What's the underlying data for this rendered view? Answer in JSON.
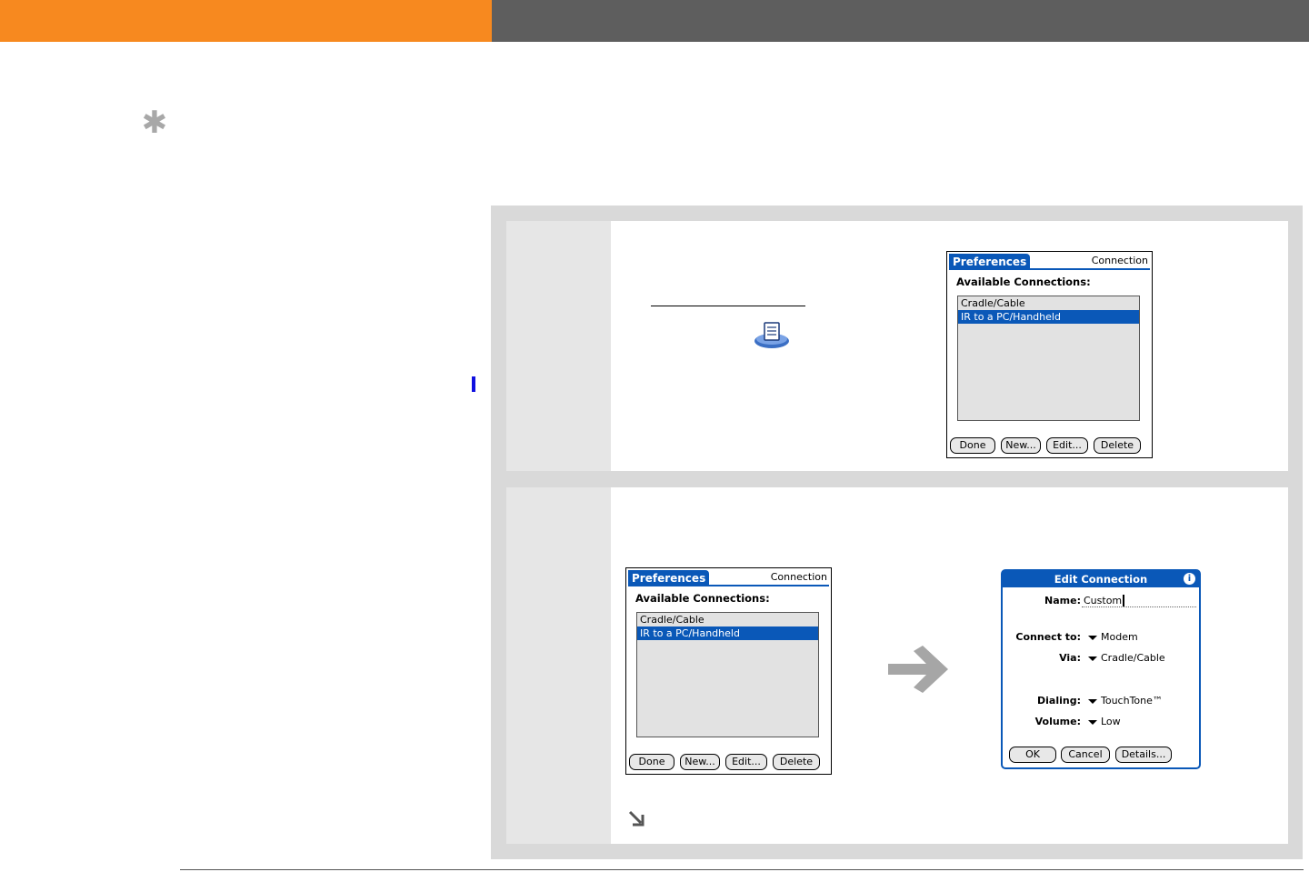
{
  "header": {
    "left_color": "#f7891f",
    "right_color": "#5e5e5e"
  },
  "tip_icon": "asterisk-tip-icon",
  "step1": {
    "app_icon": "prefs-app-icon",
    "screen": {
      "title": "Preferences",
      "panel": "Connection",
      "heading": "Available Connections:",
      "items": [
        "Cradle/Cable",
        "IR to a PC/Handheld"
      ],
      "selected_index": 1,
      "buttons": [
        "Done",
        "New...",
        "Edit...",
        "Delete"
      ]
    }
  },
  "step2": {
    "screen": {
      "title": "Preferences",
      "panel": "Connection",
      "heading": "Available Connections:",
      "items": [
        "Cradle/Cable",
        "IR to a PC/Handheld"
      ],
      "selected_index": 1,
      "buttons": [
        "Done",
        "New...",
        "Edit...",
        "Delete"
      ]
    },
    "arrow_icon": "right-arrow-icon",
    "dialog": {
      "title": "Edit Connection",
      "info_icon": "i",
      "name_label": "Name:",
      "name_value": "Custom",
      "connect_label": "Connect to:",
      "connect_value": "Modem",
      "via_label": "Via:",
      "via_value": "Cradle/Cable",
      "dialing_label": "Dialing:",
      "dialing_value": "TouchTone™",
      "volume_label": "Volume:",
      "volume_value": "Low",
      "buttons": [
        "OK",
        "Cancel",
        "Details..."
      ]
    },
    "continue_icon": "continue-arrow-icon"
  }
}
